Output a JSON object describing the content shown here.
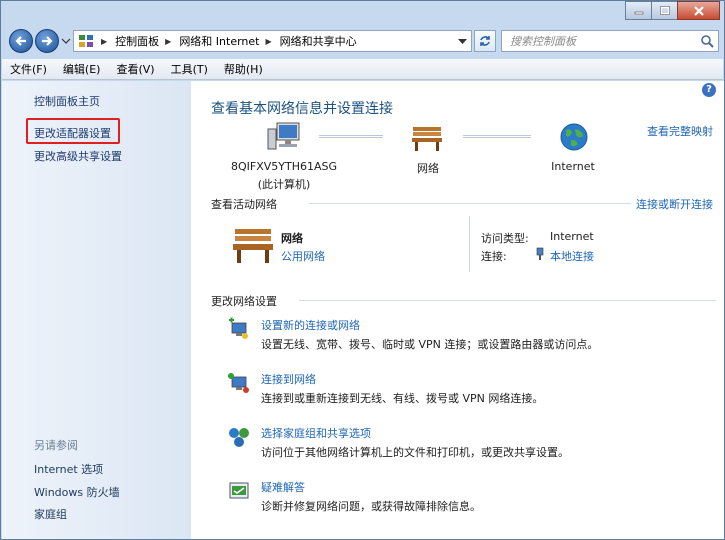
{
  "address_bar": {
    "crumbs": [
      "控制面板",
      "网络和 Internet",
      "网络和共享中心"
    ],
    "search_placeholder": "搜索控制面板"
  },
  "menu": [
    "文件(F)",
    "编辑(E)",
    "查看(V)",
    "工具(T)",
    "帮助(H)"
  ],
  "sidebar": {
    "links": [
      "控制面板主页",
      "更改适配器设置",
      "更改高级共享设置"
    ],
    "see_also_label": "另请参阅",
    "see_also_links": [
      "Internet 选项",
      "Windows 防火墙",
      "家庭组"
    ]
  },
  "main": {
    "title": "查看基本网络信息并设置连接",
    "full_map_link": "查看完整映射",
    "map": {
      "computer_name": "8QIFXV5YTH61ASG",
      "computer_sub": "(此计算机)",
      "network": "网络",
      "internet": "Internet"
    },
    "active_section": "查看活动网络",
    "connect_link": "连接或断开连接",
    "active": {
      "name": "网络",
      "type": "公用网络",
      "access_label": "访问类型:",
      "access_value": "Internet",
      "conn_label": "连接:",
      "conn_value": "本地连接"
    },
    "change_section": "更改网络设置",
    "tasks": [
      {
        "title": "设置新的连接或网络",
        "desc": "设置无线、宽带、拨号、临时或 VPN 连接；或设置路由器或访问点。"
      },
      {
        "title": "连接到网络",
        "desc": "连接到或重新连接到无线、有线、拨号或 VPN 网络连接。"
      },
      {
        "title": "选择家庭组和共享选项",
        "desc": "访问位于其他网络计算机上的文件和打印机，或更改共享设置。"
      },
      {
        "title": "疑难解答",
        "desc": "诊断并修复网络问题，或获得故障排除信息。"
      }
    ]
  },
  "colors": {
    "highlight_box": "#e02020",
    "link": "#1f66b3",
    "title": "#1c5180"
  }
}
